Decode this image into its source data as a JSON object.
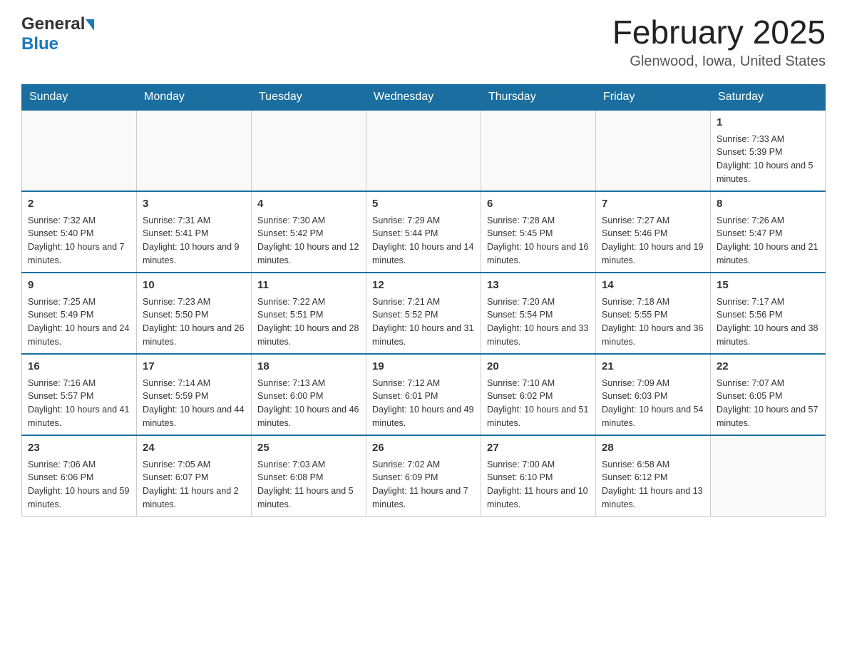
{
  "header": {
    "logo_general": "General",
    "logo_blue": "Blue",
    "title": "February 2025",
    "subtitle": "Glenwood, Iowa, United States"
  },
  "days_of_week": [
    "Sunday",
    "Monday",
    "Tuesday",
    "Wednesday",
    "Thursday",
    "Friday",
    "Saturday"
  ],
  "weeks": [
    [
      {
        "day": "",
        "info": ""
      },
      {
        "day": "",
        "info": ""
      },
      {
        "day": "",
        "info": ""
      },
      {
        "day": "",
        "info": ""
      },
      {
        "day": "",
        "info": ""
      },
      {
        "day": "",
        "info": ""
      },
      {
        "day": "1",
        "info": "Sunrise: 7:33 AM\nSunset: 5:39 PM\nDaylight: 10 hours and 5 minutes."
      }
    ],
    [
      {
        "day": "2",
        "info": "Sunrise: 7:32 AM\nSunset: 5:40 PM\nDaylight: 10 hours and 7 minutes."
      },
      {
        "day": "3",
        "info": "Sunrise: 7:31 AM\nSunset: 5:41 PM\nDaylight: 10 hours and 9 minutes."
      },
      {
        "day": "4",
        "info": "Sunrise: 7:30 AM\nSunset: 5:42 PM\nDaylight: 10 hours and 12 minutes."
      },
      {
        "day": "5",
        "info": "Sunrise: 7:29 AM\nSunset: 5:44 PM\nDaylight: 10 hours and 14 minutes."
      },
      {
        "day": "6",
        "info": "Sunrise: 7:28 AM\nSunset: 5:45 PM\nDaylight: 10 hours and 16 minutes."
      },
      {
        "day": "7",
        "info": "Sunrise: 7:27 AM\nSunset: 5:46 PM\nDaylight: 10 hours and 19 minutes."
      },
      {
        "day": "8",
        "info": "Sunrise: 7:26 AM\nSunset: 5:47 PM\nDaylight: 10 hours and 21 minutes."
      }
    ],
    [
      {
        "day": "9",
        "info": "Sunrise: 7:25 AM\nSunset: 5:49 PM\nDaylight: 10 hours and 24 minutes."
      },
      {
        "day": "10",
        "info": "Sunrise: 7:23 AM\nSunset: 5:50 PM\nDaylight: 10 hours and 26 minutes."
      },
      {
        "day": "11",
        "info": "Sunrise: 7:22 AM\nSunset: 5:51 PM\nDaylight: 10 hours and 28 minutes."
      },
      {
        "day": "12",
        "info": "Sunrise: 7:21 AM\nSunset: 5:52 PM\nDaylight: 10 hours and 31 minutes."
      },
      {
        "day": "13",
        "info": "Sunrise: 7:20 AM\nSunset: 5:54 PM\nDaylight: 10 hours and 33 minutes."
      },
      {
        "day": "14",
        "info": "Sunrise: 7:18 AM\nSunset: 5:55 PM\nDaylight: 10 hours and 36 minutes."
      },
      {
        "day": "15",
        "info": "Sunrise: 7:17 AM\nSunset: 5:56 PM\nDaylight: 10 hours and 38 minutes."
      }
    ],
    [
      {
        "day": "16",
        "info": "Sunrise: 7:16 AM\nSunset: 5:57 PM\nDaylight: 10 hours and 41 minutes."
      },
      {
        "day": "17",
        "info": "Sunrise: 7:14 AM\nSunset: 5:59 PM\nDaylight: 10 hours and 44 minutes."
      },
      {
        "day": "18",
        "info": "Sunrise: 7:13 AM\nSunset: 6:00 PM\nDaylight: 10 hours and 46 minutes."
      },
      {
        "day": "19",
        "info": "Sunrise: 7:12 AM\nSunset: 6:01 PM\nDaylight: 10 hours and 49 minutes."
      },
      {
        "day": "20",
        "info": "Sunrise: 7:10 AM\nSunset: 6:02 PM\nDaylight: 10 hours and 51 minutes."
      },
      {
        "day": "21",
        "info": "Sunrise: 7:09 AM\nSunset: 6:03 PM\nDaylight: 10 hours and 54 minutes."
      },
      {
        "day": "22",
        "info": "Sunrise: 7:07 AM\nSunset: 6:05 PM\nDaylight: 10 hours and 57 minutes."
      }
    ],
    [
      {
        "day": "23",
        "info": "Sunrise: 7:06 AM\nSunset: 6:06 PM\nDaylight: 10 hours and 59 minutes."
      },
      {
        "day": "24",
        "info": "Sunrise: 7:05 AM\nSunset: 6:07 PM\nDaylight: 11 hours and 2 minutes."
      },
      {
        "day": "25",
        "info": "Sunrise: 7:03 AM\nSunset: 6:08 PM\nDaylight: 11 hours and 5 minutes."
      },
      {
        "day": "26",
        "info": "Sunrise: 7:02 AM\nSunset: 6:09 PM\nDaylight: 11 hours and 7 minutes."
      },
      {
        "day": "27",
        "info": "Sunrise: 7:00 AM\nSunset: 6:10 PM\nDaylight: 11 hours and 10 minutes."
      },
      {
        "day": "28",
        "info": "Sunrise: 6:58 AM\nSunset: 6:12 PM\nDaylight: 11 hours and 13 minutes."
      },
      {
        "day": "",
        "info": ""
      }
    ]
  ]
}
